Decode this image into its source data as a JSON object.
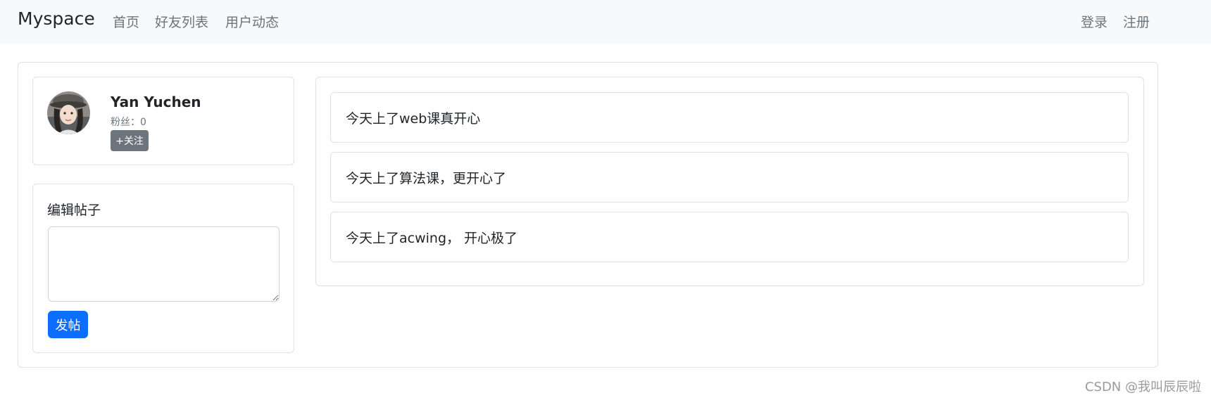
{
  "navbar": {
    "brand": "Myspace",
    "links": [
      "首页",
      "好友列表",
      "用户动态"
    ],
    "auth": [
      "登录",
      "注册"
    ]
  },
  "profile": {
    "name": "Yan Yuchen",
    "fans": "粉丝：0",
    "follow_label": "+关注"
  },
  "editor": {
    "title": "编辑帖子",
    "value": "",
    "submit_label": "发帖"
  },
  "posts": [
    "今天上了web课真开心",
    "今天上了算法课，更开心了",
    "今天上了acwing， 开心极了"
  ],
  "watermark": "CSDN @我叫辰辰啦",
  "colors": {
    "navbar_bg": "#f8f9fa",
    "primary": "#0d6efd",
    "secondary": "#6c757d",
    "border": "#dee2e6"
  }
}
